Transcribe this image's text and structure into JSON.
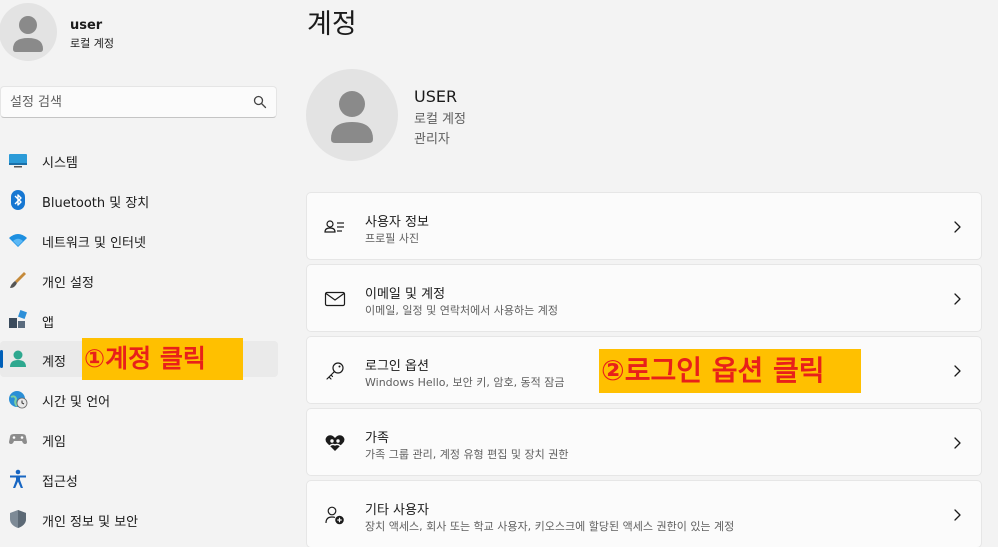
{
  "profile": {
    "name": "user",
    "account_type": "로컬 계정"
  },
  "search": {
    "placeholder": "설정 검색"
  },
  "sidebar": {
    "items": [
      {
        "label": "시스템",
        "icon": "display-icon"
      },
      {
        "label": "Bluetooth 및 장치",
        "icon": "bluetooth-icon"
      },
      {
        "label": "네트워크 및 인터넷",
        "icon": "wifi-icon"
      },
      {
        "label": "개인 설정",
        "icon": "brush-icon"
      },
      {
        "label": "앱",
        "icon": "apps-icon"
      },
      {
        "label": "계정",
        "icon": "person-icon",
        "selected": true
      },
      {
        "label": "시간 및 언어",
        "icon": "globe-clock-icon"
      },
      {
        "label": "게임",
        "icon": "gamepad-icon"
      },
      {
        "label": "접근성",
        "icon": "accessibility-icon"
      },
      {
        "label": "개인 정보 및 보안",
        "icon": "shield-icon"
      }
    ]
  },
  "main": {
    "title": "계정",
    "user": {
      "name": "USER",
      "account_type": "로컬 계정",
      "role": "관리자"
    },
    "cards": [
      {
        "title": "사용자 정보",
        "desc": "프로필 사진",
        "icon": "user-info-icon"
      },
      {
        "title": "이메일 및 계정",
        "desc": "이메일, 일정 및 연락처에서 사용하는 계정",
        "icon": "mail-icon"
      },
      {
        "title": "로그인 옵션",
        "desc": "Windows Hello, 보안 키, 암호, 동적 잠금",
        "icon": "key-icon"
      },
      {
        "title": "가족",
        "desc": "가족 그룹 관리, 계정 유형 편집 및 장치 권한",
        "icon": "family-heart-icon"
      },
      {
        "title": "기타 사용자",
        "desc": "장치 액세스, 회사 또는 학교 사용자, 키오스크에 할당된 액세스 권한이 있는 계정",
        "icon": "add-user-icon"
      }
    ]
  },
  "annotations": {
    "step1": "①계정 클릭",
    "step2": "②로그인 옵션 클릭"
  },
  "colors": {
    "accent": "#005fb8",
    "annotation_bg": "#ffc000",
    "annotation_text": "#e8201a",
    "background": "#f3f3f3",
    "card": "#fbfbfb"
  }
}
